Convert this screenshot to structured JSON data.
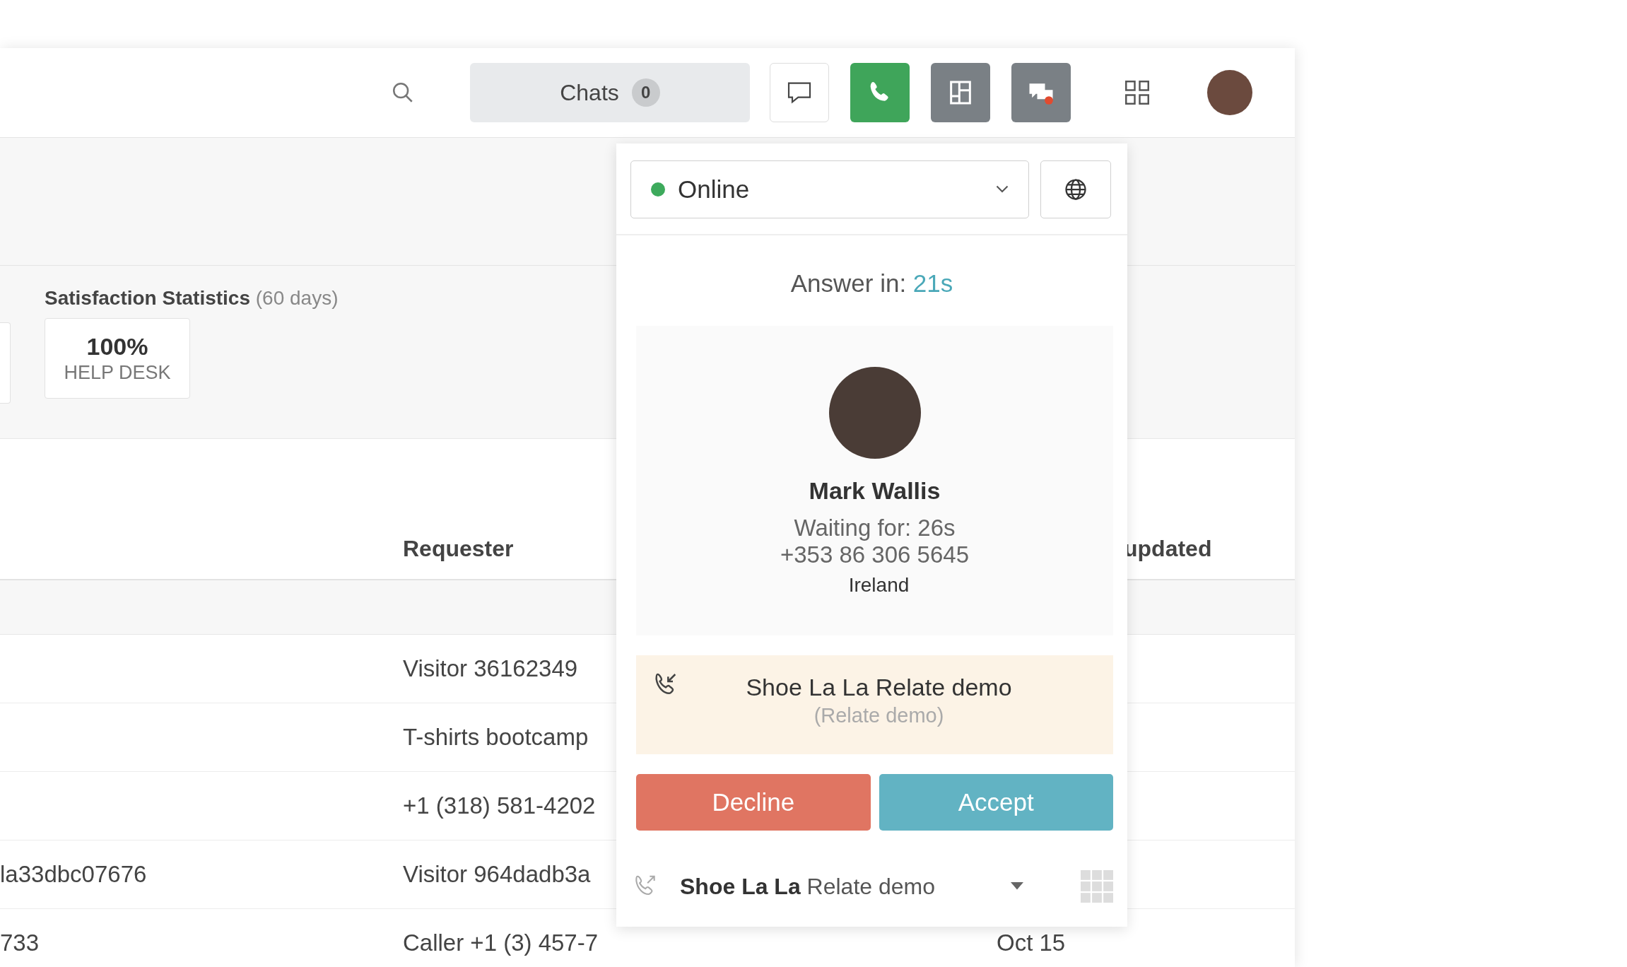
{
  "top_bar": {
    "chats_button": {
      "label": "Chats",
      "count": "0"
    },
    "toolbar_buttons": [
      {
        "kind": "chat",
        "selected": false
      },
      {
        "kind": "phone",
        "selected": true
      },
      {
        "kind": "layout",
        "selected": false
      },
      {
        "kind": "chat-alert",
        "selected": false
      }
    ]
  },
  "stats": {
    "title": "Satisfaction Statistics",
    "period": "(60 days)",
    "card": {
      "value": "100%",
      "label": "HELP DESK"
    }
  },
  "table": {
    "columns": [
      "Requester",
      "updated"
    ],
    "rows": [
      {
        "requester": "Visitor 36162349"
      },
      {
        "requester": "T-shirts bootcamp"
      },
      {
        "requester": "+1 (318) 581-4202"
      },
      {
        "column_1": "la33dbc07676",
        "requester": "Visitor 964dadb3a"
      },
      {
        "column_1": "733",
        "requester": "Caller +1 (3) 457-7",
        "updated": "Oct 15"
      }
    ]
  },
  "call_popup": {
    "status": "Online",
    "answer_label": "Answer in:",
    "answer_time": "21s",
    "caller": {
      "name": "Mark Wallis",
      "waiting": "Waiting for: 26s",
      "phone": "+353 86 306 5645",
      "country": "Ireland"
    },
    "call_line": {
      "title": "Shoe La La Relate demo",
      "subtitle": "(Relate demo)"
    },
    "buttons": [
      {
        "kind": "decline",
        "label": "Decline"
      },
      {
        "kind": "accept",
        "label": "Accept"
      }
    ],
    "line_selector": {
      "company": "Shoe La La",
      "line": "Relate demo"
    }
  }
}
